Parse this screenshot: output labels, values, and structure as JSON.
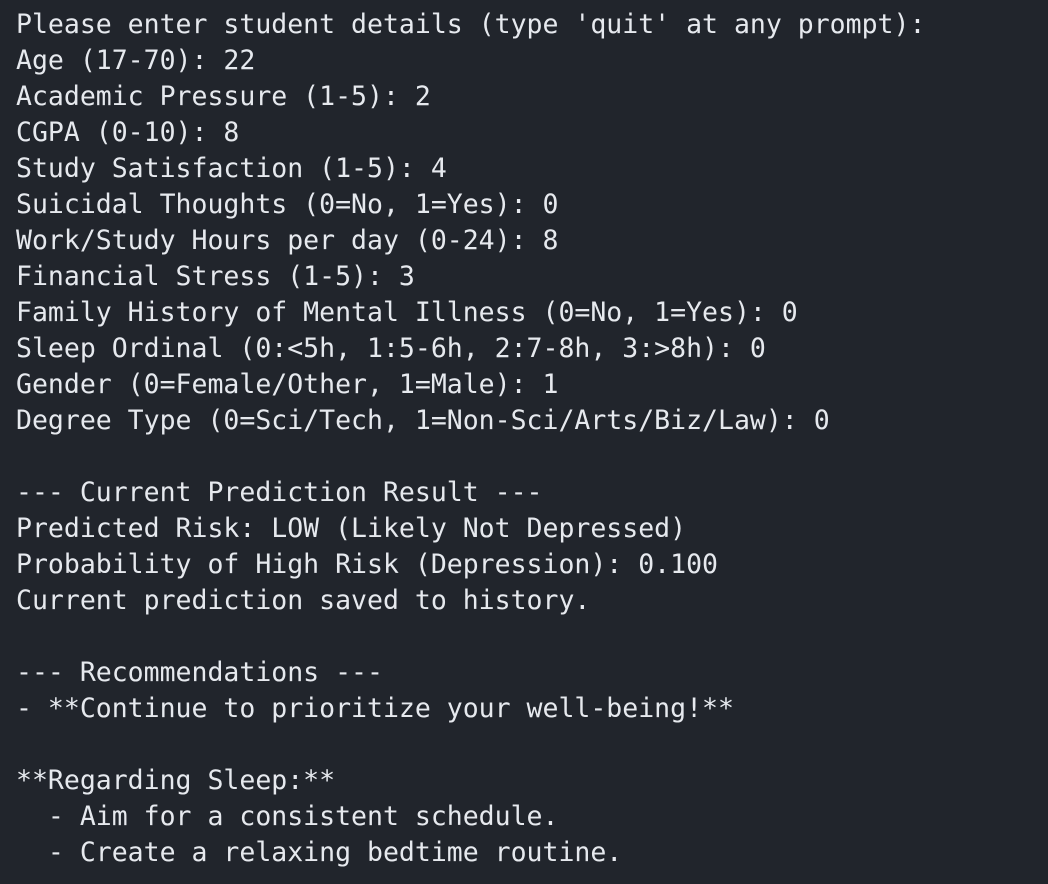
{
  "terminal": {
    "lines": [
      "Please enter student details (type 'quit' at any prompt):",
      "Age (17-70): 22",
      "Academic Pressure (1-5): 2",
      "CGPA (0-10): 8",
      "Study Satisfaction (1-5): 4",
      "Suicidal Thoughts (0=No, 1=Yes): 0",
      "Work/Study Hours per day (0-24): 8",
      "Financial Stress (1-5): 3",
      "Family History of Mental Illness (0=No, 1=Yes): 0",
      "Sleep Ordinal (0:<5h, 1:5-6h, 2:7-8h, 3:>8h): 0",
      "Gender (0=Female/Other, 1=Male): 1",
      "Degree Type (0=Sci/Tech, 1=Non-Sci/Arts/Biz/Law): 0",
      "",
      "--- Current Prediction Result ---",
      "Predicted Risk: LOW (Likely Not Depressed)",
      "Probability of High Risk (Depression): 0.100",
      "Current prediction saved to history.",
      "",
      "--- Recommendations ---",
      "- **Continue to prioritize your well-being!**",
      "",
      "**Regarding Sleep:**",
      "  - Aim for a consistent schedule.",
      "  - Create a relaxing bedtime routine."
    ]
  }
}
